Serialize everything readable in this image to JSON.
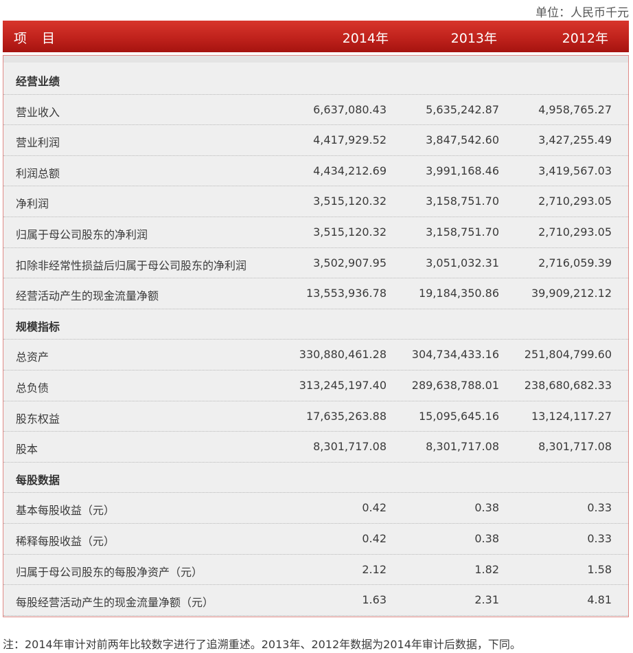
{
  "unit": "单位：人民币千元",
  "header": {
    "item": "项 目",
    "years": [
      "2014年",
      "2013年",
      "2012年"
    ]
  },
  "rows": [
    {
      "label": "经营业绩",
      "section": true
    },
    {
      "label": "营业收入",
      "values": [
        "6,637,080.43",
        "5,635,242.87",
        "4,958,765.27"
      ]
    },
    {
      "label": "营业利润",
      "values": [
        "4,417,929.52",
        "3,847,542.60",
        "3,427,255.49"
      ]
    },
    {
      "label": "利润总额",
      "values": [
        "4,434,212.69",
        "3,991,168.46",
        "3,419,567.03"
      ]
    },
    {
      "label": "净利润",
      "values": [
        "3,515,120.32",
        "3,158,751.70",
        "2,710,293.05"
      ]
    },
    {
      "label": "归属于母公司股东的净利润",
      "values": [
        "3,515,120.32",
        "3,158,751.70",
        "2,710,293.05"
      ]
    },
    {
      "label": "扣除非经常性损益后归属于母公司股东的净利润",
      "values": [
        "3,502,907.95",
        "3,051,032.31",
        "2,716,059.39"
      ]
    },
    {
      "label": "经营活动产生的现金流量净额",
      "values": [
        "13,553,936.78",
        "19,184,350.86",
        "39,909,212.12"
      ]
    },
    {
      "label": "规模指标",
      "section": true
    },
    {
      "label": "总资产",
      "values": [
        "330,880,461.28",
        "304,734,433.16",
        "251,804,799.60"
      ]
    },
    {
      "label": "总负债",
      "values": [
        "313,245,197.40",
        "289,638,788.01",
        "238,680,682.33"
      ]
    },
    {
      "label": "股东权益",
      "values": [
        "17,635,263.88",
        "15,095,645.16",
        "13,124,117.27"
      ]
    },
    {
      "label": "股本",
      "values": [
        "8,301,717.08",
        "8,301,717.08",
        "8,301,717.08"
      ]
    },
    {
      "label": "每股数据",
      "section": true
    },
    {
      "label": "基本每股收益（元）",
      "values": [
        "0.42",
        "0.38",
        "0.33"
      ]
    },
    {
      "label": "稀释每股收益（元）",
      "values": [
        "0.42",
        "0.38",
        "0.33"
      ]
    },
    {
      "label": "归属于母公司股东的每股净资产（元）",
      "values": [
        "2.12",
        "1.82",
        "1.58"
      ]
    },
    {
      "label": "每股经营活动产生的现金流量净额（元）",
      "values": [
        "1.63",
        "2.31",
        "4.81"
      ]
    }
  ],
  "note": "注：2014年审计对前两年比较数字进行了追溯重述。2013年、2012年数据为2014年审计后数据，下同。",
  "colors": {
    "header_red": "#c0221c",
    "table_bg": "#efefef"
  }
}
